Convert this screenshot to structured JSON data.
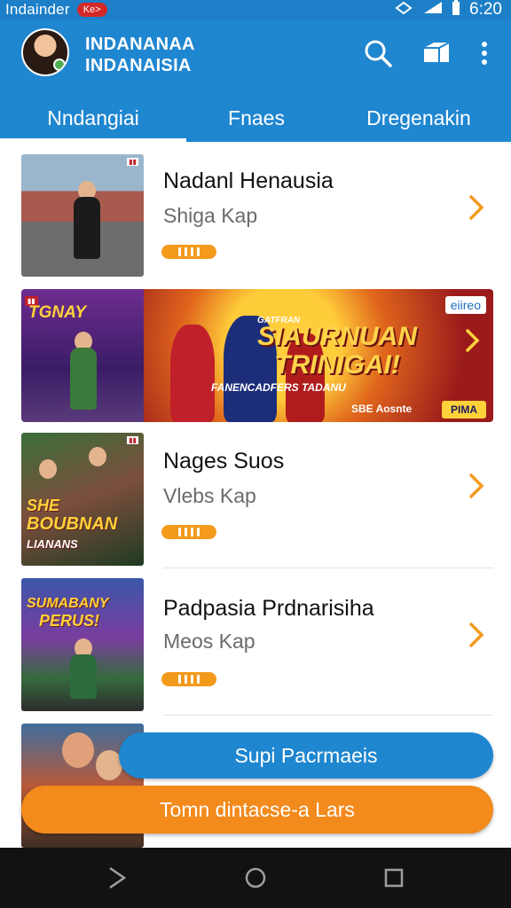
{
  "status_bar": {
    "carrier": "Indainder",
    "badge": "Ke>",
    "time": "6:20",
    "icons": [
      "signal-icon",
      "wifi-icon",
      "battery-icon"
    ]
  },
  "app_bar": {
    "title_line1": "INDANANAA",
    "title_line2": "INDANAISIA",
    "actions": [
      "search-icon",
      "store-icon",
      "more-vert-icon"
    ]
  },
  "tabs": [
    {
      "label": "Nndangiai",
      "active": true
    },
    {
      "label": "Fnaes",
      "active": false
    },
    {
      "label": "Dregenakin",
      "active": false
    }
  ],
  "list": {
    "items": [
      {
        "title": "Nadanl Henausia",
        "subtitle": "Shiga Kap"
      },
      {
        "title": "Nages Suos",
        "subtitle": "Vlebs Kap",
        "thumb_text_top": "SHE",
        "thumb_text_bottom": "BOUBNAN",
        "thumb_text_small": "LIANANS"
      },
      {
        "title": "Padpasia Prdnarisiha",
        "subtitle": "Meos Kap",
        "thumb_text_top": "SUMABANY",
        "thumb_text_bottom": "PERUS!"
      }
    ]
  },
  "banner": {
    "left_title": "TGNAY",
    "logo": "eiireo",
    "kicker": "GATFRAN",
    "headline_line1": "SIAURNUAN",
    "headline_line2": "TRINIGAI!",
    "small_text": "FANENCADFERS TADANU",
    "bottom_text": "SBE Aosnte",
    "play_label": "PIMA"
  },
  "buttons": {
    "secondary": "Supi Pacrmaeis",
    "primary": "Tomn dintacse-a Lars"
  },
  "colors": {
    "primary_blue": "#1f86d0",
    "accent_orange": "#f28a1c",
    "nav_bar": "#121212"
  }
}
